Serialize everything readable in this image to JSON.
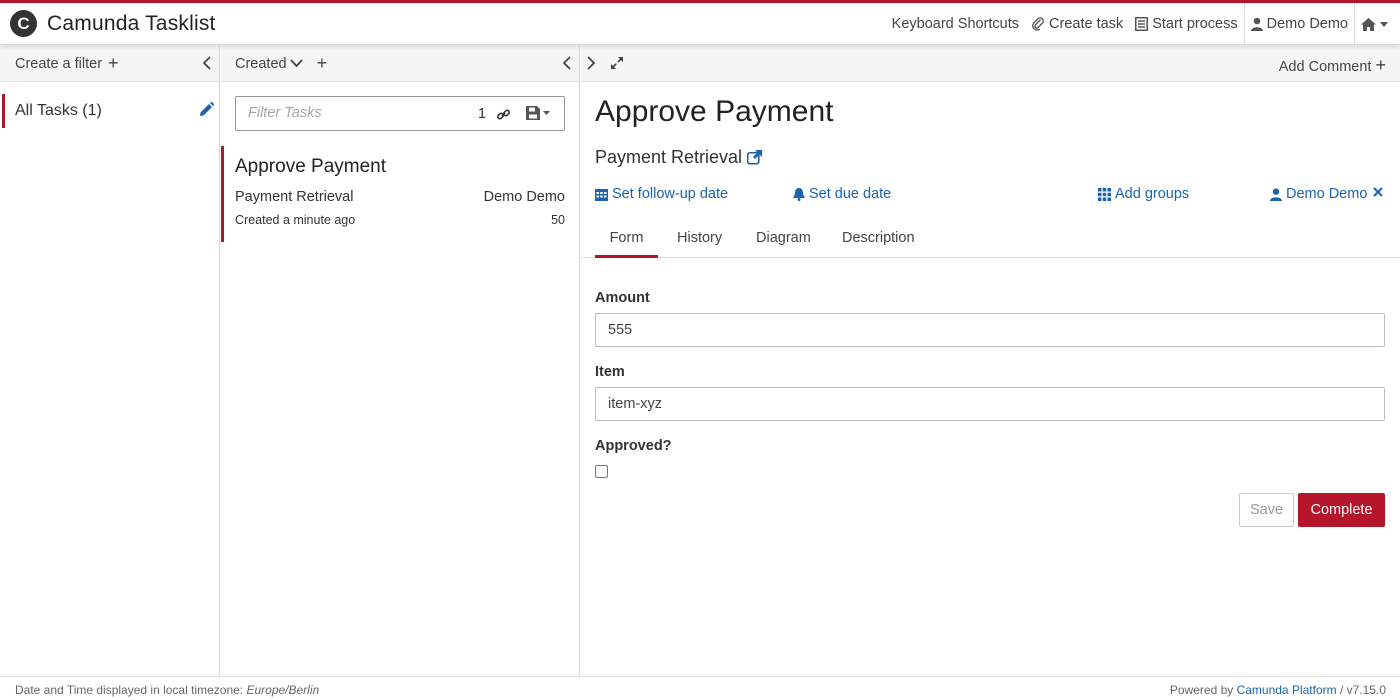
{
  "header": {
    "logo_letter": "C",
    "title": "Camunda Tasklist",
    "nav": {
      "keyboard_shortcuts": "Keyboard Shortcuts",
      "create_task": "Create task",
      "start_process": "Start process",
      "user": "Demo Demo"
    },
    "accent_color": "#b5152b"
  },
  "filters": {
    "header_label": "Create a filter",
    "items": [
      {
        "label": "All Tasks (1)"
      }
    ]
  },
  "tasklist": {
    "sort_label": "Created",
    "search_placeholder": "Filter Tasks",
    "search_count": "1",
    "tasks": [
      {
        "name": "Approve Payment",
        "process": "Payment Retrieval",
        "assignee": "Demo Demo",
        "created": "Created a minute ago",
        "priority": "50"
      }
    ]
  },
  "detail": {
    "add_comment": "Add Comment",
    "title": "Approve Payment",
    "process_link": "Payment Retrieval",
    "actions": {
      "follow_up": "Set follow-up date",
      "due_date": "Set due date",
      "add_groups": "Add groups",
      "assignee": "Demo Demo"
    },
    "tabs": [
      "Form",
      "History",
      "Diagram",
      "Description"
    ],
    "active_tab": "Form",
    "form": {
      "amount_label": "Amount",
      "amount_value": "555",
      "item_label": "Item",
      "item_value": "item-xyz",
      "approved_label": "Approved?",
      "approved_checked": false,
      "save_label": "Save",
      "complete_label": "Complete"
    }
  },
  "footer": {
    "timezone_prefix": "Date and Time displayed in local timezone: ",
    "timezone": "Europe/Berlin",
    "powered_prefix": "Powered by ",
    "powered_link": "Camunda Platform",
    "version": " / v7.15.0"
  }
}
